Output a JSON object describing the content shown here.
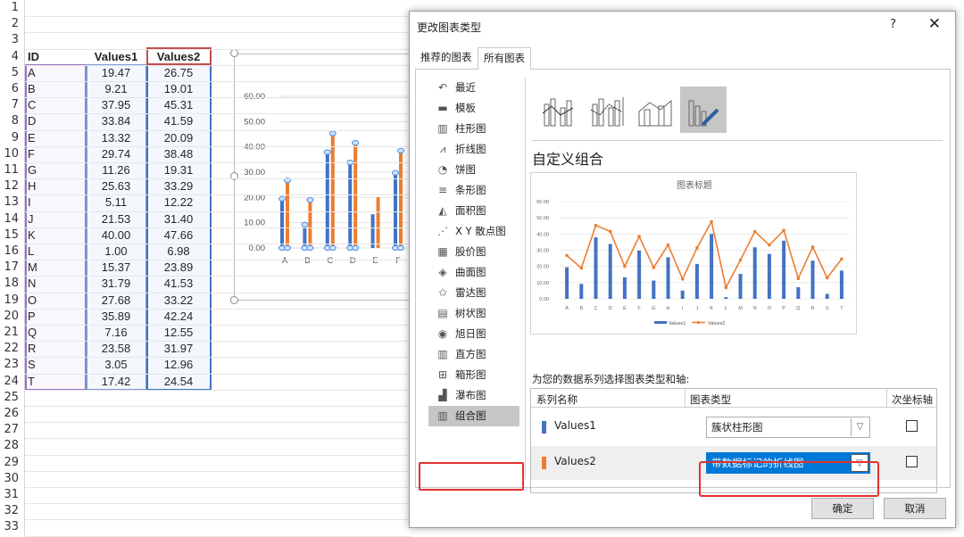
{
  "sheet": {
    "row_numbers": [
      "1",
      "2",
      "3",
      "4",
      "5",
      "6",
      "7",
      "8",
      "9",
      "10",
      "11",
      "12",
      "13",
      "14",
      "15",
      "16",
      "17",
      "18",
      "19",
      "20",
      "21",
      "22",
      "23",
      "24",
      "25",
      "26",
      "27",
      "28",
      "29",
      "30",
      "31",
      "32",
      "33"
    ],
    "headers": {
      "id": "ID",
      "v1": "Values1",
      "v2": "Values2"
    },
    "rows": [
      {
        "id": "A",
        "v1": "19.47",
        "v2": "26.75"
      },
      {
        "id": "B",
        "v1": "9.21",
        "v2": "19.01"
      },
      {
        "id": "C",
        "v1": "37.95",
        "v2": "45.31"
      },
      {
        "id": "D",
        "v1": "33.84",
        "v2": "41.59"
      },
      {
        "id": "E",
        "v1": "13.32",
        "v2": "20.09"
      },
      {
        "id": "F",
        "v1": "29.74",
        "v2": "38.48"
      },
      {
        "id": "G",
        "v1": "11.26",
        "v2": "19.31"
      },
      {
        "id": "H",
        "v1": "25.63",
        "v2": "33.29"
      },
      {
        "id": "I",
        "v1": "5.11",
        "v2": "12.22"
      },
      {
        "id": "J",
        "v1": "21.53",
        "v2": "31.40"
      },
      {
        "id": "K",
        "v1": "40.00",
        "v2": "47.66"
      },
      {
        "id": "L",
        "v1": "1.00",
        "v2": "6.98"
      },
      {
        "id": "M",
        "v1": "15.37",
        "v2": "23.89"
      },
      {
        "id": "N",
        "v1": "31.79",
        "v2": "41.53"
      },
      {
        "id": "O",
        "v1": "27.68",
        "v2": "33.22"
      },
      {
        "id": "P",
        "v1": "35.89",
        "v2": "42.24"
      },
      {
        "id": "Q",
        "v1": "7.16",
        "v2": "12.55"
      },
      {
        "id": "R",
        "v1": "23.58",
        "v2": "31.97"
      },
      {
        "id": "S",
        "v1": "3.05",
        "v2": "12.96"
      },
      {
        "id": "T",
        "v1": "17.42",
        "v2": "24.54"
      }
    ]
  },
  "embedded_chart": {
    "y_ticks": [
      "60.00",
      "50.00",
      "40.00",
      "30.00",
      "20.00",
      "10.00",
      "0.00"
    ],
    "x_labels": [
      "A",
      "B",
      "C",
      "D",
      "E",
      "F"
    ]
  },
  "dialog": {
    "title": "更改图表类型",
    "help": "?",
    "close": "✕",
    "tabs": {
      "recommended": "推荐的图表",
      "all": "所有图表"
    },
    "chart_types": [
      {
        "icon": "recent-icon",
        "label": "最近"
      },
      {
        "icon": "template-icon",
        "label": "模板"
      },
      {
        "icon": "column-chart-icon",
        "label": "柱形图"
      },
      {
        "icon": "line-chart-icon",
        "label": "折线图"
      },
      {
        "icon": "pie-chart-icon",
        "label": "饼图"
      },
      {
        "icon": "bar-chart-icon",
        "label": "条形图"
      },
      {
        "icon": "area-chart-icon",
        "label": "面积图"
      },
      {
        "icon": "scatter-chart-icon",
        "label": "X Y 散点图"
      },
      {
        "icon": "stock-chart-icon",
        "label": "股价图"
      },
      {
        "icon": "surface-chart-icon",
        "label": "曲面图"
      },
      {
        "icon": "radar-chart-icon",
        "label": "雷达图"
      },
      {
        "icon": "treemap-chart-icon",
        "label": "树状图"
      },
      {
        "icon": "sunburst-chart-icon",
        "label": "旭日图"
      },
      {
        "icon": "histogram-chart-icon",
        "label": "直方图"
      },
      {
        "icon": "boxwhisker-chart-icon",
        "label": "箱形图"
      },
      {
        "icon": "waterfall-chart-icon",
        "label": "瀑布图"
      },
      {
        "icon": "combo-chart-icon",
        "label": "组合图"
      }
    ],
    "selected_type": "组合图",
    "combo_heading": "自定义组合",
    "preview_title": "图表标题",
    "series_prompt": "为您的数据系列选择图表类型和轴:",
    "table_headers": {
      "name": "系列名称",
      "type": "图表类型",
      "secondary": "次坐标轴"
    },
    "series": [
      {
        "name": "Values1",
        "type": "簇状柱形图",
        "secondary_axis": false,
        "color": "#4472c4"
      },
      {
        "name": "Values2",
        "type": "带数据标记的折线图",
        "secondary_axis": false,
        "color": "#ed7d31"
      }
    ],
    "ok": "确定",
    "cancel": "取消"
  },
  "colors": {
    "series1": "#4472c4",
    "series2": "#ed7d31",
    "highlight": "#e3302f"
  },
  "chart_data": [
    {
      "type": "bar",
      "categories": [
        "A",
        "B",
        "C",
        "D",
        "E",
        "F"
      ],
      "series": [
        {
          "values": [
            19.47,
            9.21,
            37.95,
            33.84,
            13.32,
            29.74
          ]
        },
        {
          "values": [
            26.75,
            19.01,
            45.31,
            41.59,
            20.09,
            38.48
          ]
        }
      ],
      "ylim": [
        0,
        60
      ],
      "y_ticks": [
        0,
        10,
        20,
        30,
        40,
        50,
        60
      ]
    },
    {
      "type": "bar",
      "title": "图表标题",
      "categories": [
        "A",
        "B",
        "C",
        "D",
        "E",
        "F",
        "G",
        "H",
        "I",
        "J",
        "K",
        "L",
        "M",
        "N",
        "O",
        "P",
        "Q",
        "R",
        "S",
        "T"
      ],
      "series": [
        {
          "name": "Values1",
          "type": "bar",
          "values": [
            19.47,
            9.21,
            37.95,
            33.84,
            13.32,
            29.74,
            11.26,
            25.63,
            5.11,
            21.53,
            40.0,
            1.0,
            15.37,
            31.79,
            27.68,
            35.89,
            7.16,
            23.58,
            3.05,
            17.42
          ]
        },
        {
          "name": "Values2",
          "type": "line",
          "values": [
            26.75,
            19.01,
            45.31,
            41.59,
            20.09,
            38.48,
            19.31,
            33.29,
            12.22,
            31.4,
            47.66,
            6.98,
            23.89,
            41.53,
            33.22,
            42.24,
            12.55,
            31.97,
            12.96,
            24.54
          ]
        }
      ],
      "ylim": [
        0,
        60
      ],
      "y_ticks": [
        0,
        10,
        20,
        30,
        40,
        50,
        60
      ],
      "legend": "bottom"
    }
  ]
}
